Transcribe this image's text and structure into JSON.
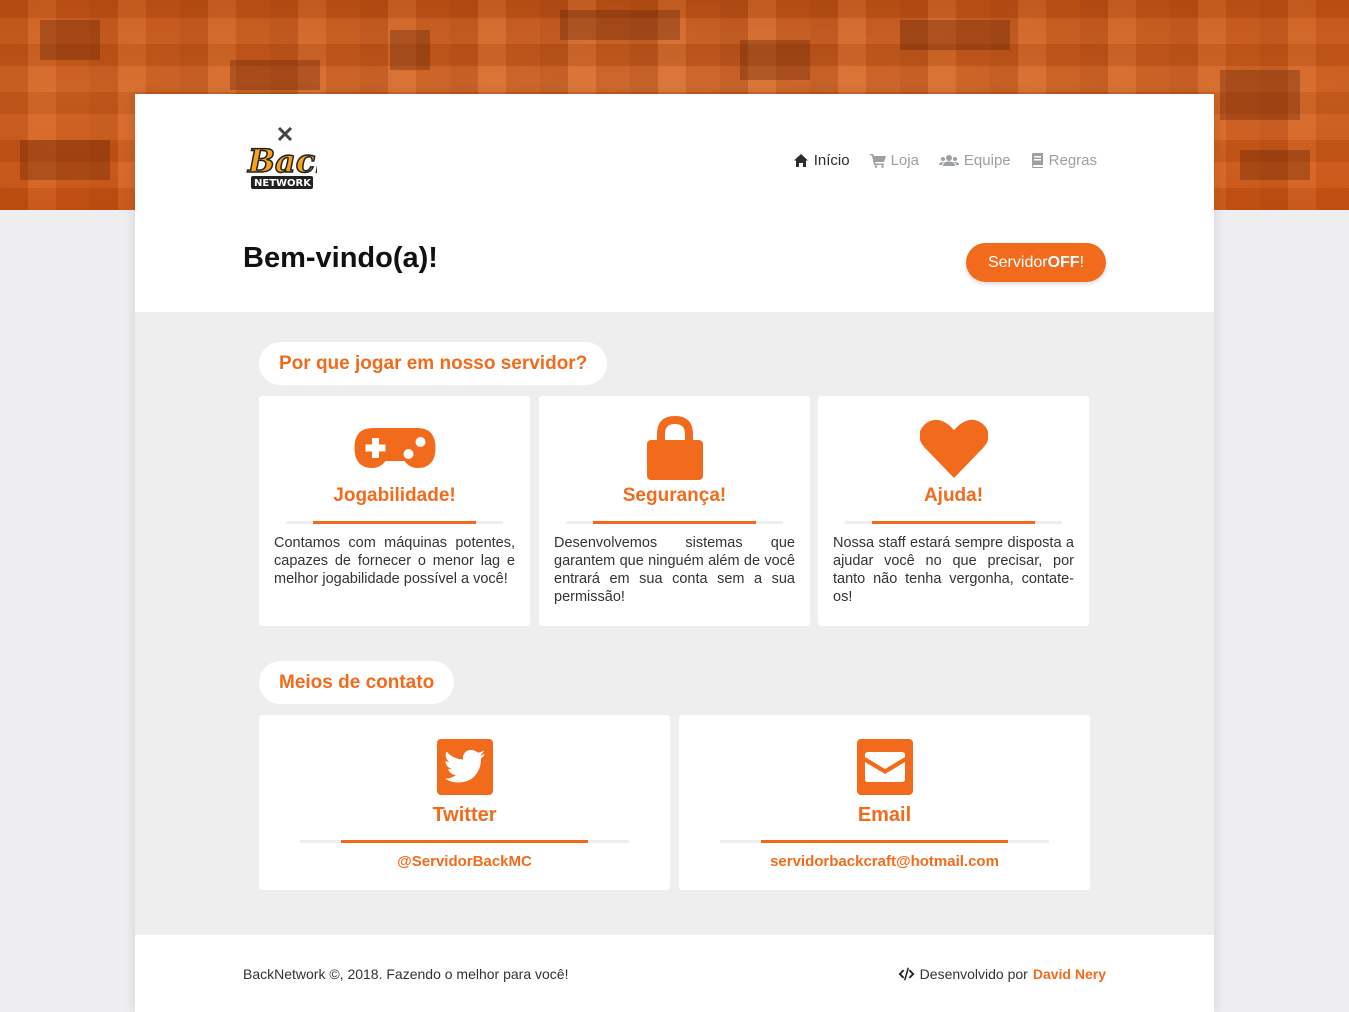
{
  "nav": [
    {
      "label": "Início",
      "icon": "home-icon",
      "active": true
    },
    {
      "label": "Loja",
      "icon": "cart-icon",
      "active": false
    },
    {
      "label": "Equipe",
      "icon": "users-icon",
      "active": false
    },
    {
      "label": "Regras",
      "icon": "book-icon",
      "active": false
    }
  ],
  "logo": {
    "text_top": "Back",
    "text_bottom": "NETWORK"
  },
  "header": {
    "welcome": "Bem-vindo(a)!",
    "status_prefix": "Servidor ",
    "status_value": "OFF",
    "status_suffix": "!"
  },
  "why": {
    "heading": "Por que jogar em nosso servidor?",
    "features": [
      {
        "icon": "gamepad-icon",
        "title": "Jogabilidade!",
        "desc": "Contamos com máquinas potentes, capazes de fornecer o menor lag e melhor jogabilidade possível a você!"
      },
      {
        "icon": "lock-icon",
        "title": "Segurança!",
        "desc": "Desenvolvemos sistemas que garantem que ninguém além de você entrará em sua conta sem a sua permissão!"
      },
      {
        "icon": "heart-icon",
        "title": "Ajuda!",
        "desc": "Nossa staff estará sempre disposta a ajudar você no que precisar, por tanto não tenha vergonha, contate-os!"
      }
    ]
  },
  "contact": {
    "heading": "Meios de contato",
    "items": [
      {
        "icon": "twitter-icon",
        "title": "Twitter",
        "value": "@ServidorBackMC"
      },
      {
        "icon": "envelope-icon",
        "title": "Email",
        "value": "servidorbackcraft@hotmail.com"
      }
    ]
  },
  "footer": {
    "copyright": "BackNetwork ©, 2018. Fazendo o melhor para você!",
    "dev_prefix": "Desenvolvido por ",
    "dev_name": "David Nery"
  },
  "colors": {
    "accent": "#f26b1c",
    "banner": "#d25818",
    "panel": "#eeeeee"
  }
}
